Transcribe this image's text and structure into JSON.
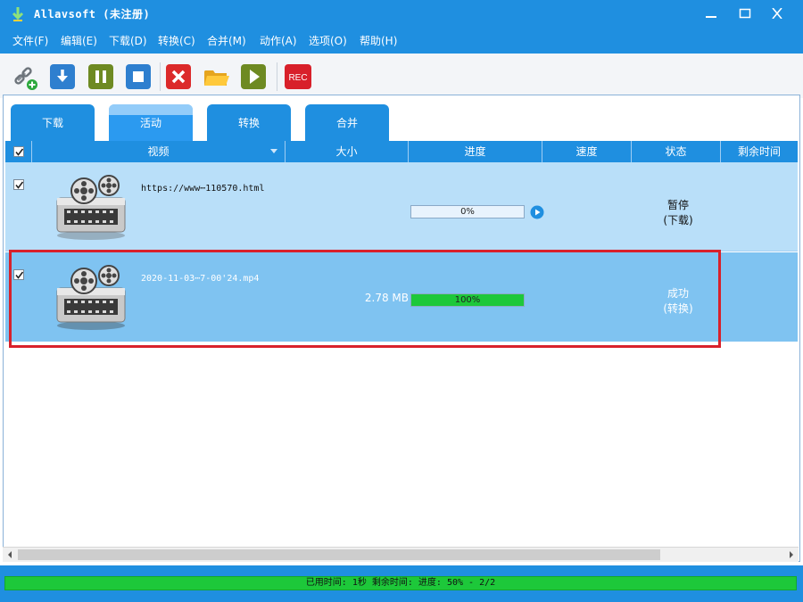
{
  "window": {
    "title": "Allavsoft (未注册)",
    "icons": {
      "app": "download-arrow-icon",
      "minimize": "minimize-icon",
      "maximize": "maximize-icon",
      "close": "close-icon"
    }
  },
  "menu": [
    {
      "label": "文件(F)"
    },
    {
      "label": "编辑(E)"
    },
    {
      "label": "下载(D)"
    },
    {
      "label": "转换(C)"
    },
    {
      "label": "合并(M)"
    },
    {
      "label": "动作(A)"
    },
    {
      "label": "选项(O)"
    },
    {
      "label": "帮助(H)"
    }
  ],
  "toolbar": {
    "buttons": [
      {
        "icon": "paste-link-icon"
      },
      {
        "icon": "download-icon"
      },
      {
        "icon": "pause-icon"
      },
      {
        "icon": "stop-icon"
      },
      {
        "icon": "delete-icon"
      },
      {
        "icon": "open-folder-icon"
      },
      {
        "icon": "play-icon"
      },
      {
        "icon": "record-icon",
        "label": "REC"
      }
    ]
  },
  "tabs": [
    {
      "label": "下载",
      "active": false
    },
    {
      "label": "活动",
      "active": true
    },
    {
      "label": "转换",
      "active": false
    },
    {
      "label": "合并",
      "active": false
    }
  ],
  "table": {
    "columns": [
      "视频",
      "大小",
      "进度",
      "速度",
      "状态",
      "剩余时间"
    ],
    "rows": [
      {
        "checked": true,
        "name": "https://www⋯110570.html",
        "size": "",
        "progress": 0,
        "progress_text": "0%",
        "speed": "",
        "status": "暂停",
        "status_sub": "(下载)",
        "remaining": ""
      },
      {
        "checked": true,
        "name": "2020-11-03⋯7-00'24.mp4",
        "size": "2.78 MB",
        "progress": 100,
        "progress_text": "100%",
        "speed": "",
        "status": "成功",
        "status_sub": "(转换)",
        "remaining": ""
      }
    ]
  },
  "statusbar": {
    "text": "已用时间: 1秒 剩余时间: 进度: 50% - 2/2",
    "progress": 100
  },
  "colors": {
    "accent": "#1f8fe0",
    "row_normal": "#b9dff9",
    "row_selected": "#7fc3f1",
    "progress_fill": "#1dc83a",
    "highlight_box": "#d8212b"
  }
}
